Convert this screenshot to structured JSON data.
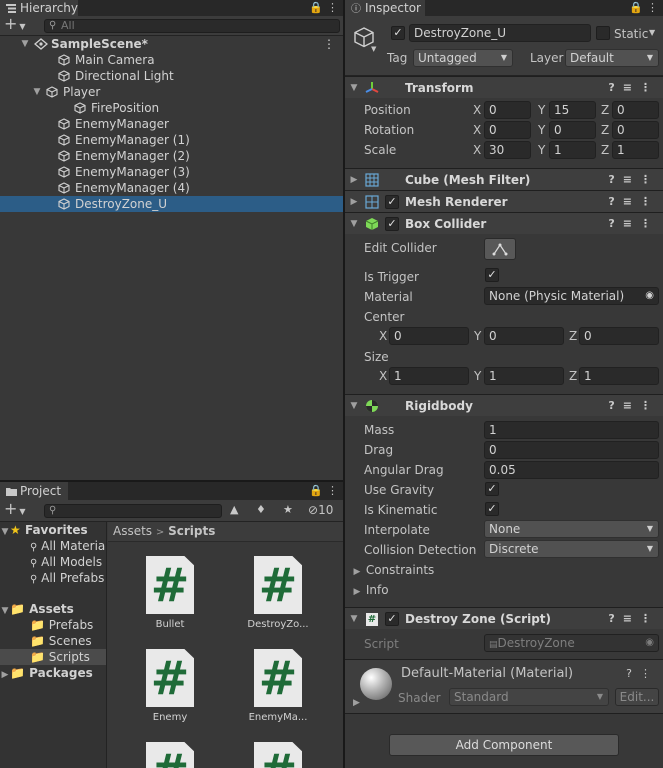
{
  "hierarchy": {
    "tab": "Hierarchy",
    "add": "+",
    "search_placeholder": "All",
    "items": [
      {
        "label": "SampleScene*",
        "kind": "scene"
      },
      {
        "label": "Main Camera",
        "kind": "go"
      },
      {
        "label": "Directional Light",
        "kind": "go"
      },
      {
        "label": "Player",
        "kind": "go"
      },
      {
        "label": "FirePosition",
        "kind": "go"
      },
      {
        "label": "EnemyManager",
        "kind": "go"
      },
      {
        "label": "EnemyManager (1)",
        "kind": "go"
      },
      {
        "label": "EnemyManager (2)",
        "kind": "go"
      },
      {
        "label": "EnemyManager (3)",
        "kind": "go"
      },
      {
        "label": "EnemyManager (4)",
        "kind": "go"
      },
      {
        "label": "DestroyZone_U",
        "kind": "go",
        "selected": true
      }
    ]
  },
  "project": {
    "tab": "Project",
    "add": "+",
    "hidden_count": "10",
    "favorites": {
      "label": "Favorites",
      "items": [
        "All Materia",
        "All Models",
        "All Prefabs"
      ]
    },
    "assets": {
      "label": "Assets",
      "items": [
        "Prefabs",
        "Scenes",
        "Scripts"
      ]
    },
    "packages": "Packages",
    "breadcrumb": {
      "root": "Assets",
      "sep": ">",
      "current": "Scripts"
    },
    "files": [
      {
        "name": "Bullet",
        "glyph": "#"
      },
      {
        "name": "DestroyZo...",
        "glyph": "#"
      },
      {
        "name": "Enemy",
        "glyph": "#"
      },
      {
        "name": "EnemyMa...",
        "glyph": "#"
      },
      {
        "name": "",
        "glyph": "#"
      },
      {
        "name": "",
        "glyph": "#"
      }
    ]
  },
  "inspector": {
    "tab": "Inspector",
    "object_name": "DestroyZone_U",
    "static_label": "Static",
    "tag_label": "Tag",
    "tag_value": "Untagged",
    "layer_label": "Layer",
    "layer_value": "Default",
    "transform": {
      "title": "Transform",
      "rows": [
        {
          "label": "Position",
          "x": "0",
          "y": "15",
          "z": "0"
        },
        {
          "label": "Rotation",
          "x": "0",
          "y": "0",
          "z": "0"
        },
        {
          "label": "Scale",
          "x": "30",
          "y": "1",
          "z": "1"
        }
      ]
    },
    "axes": {
      "x": "X",
      "y": "Y",
      "z": "Z"
    },
    "mesh_filter": {
      "title": "Cube (Mesh Filter)"
    },
    "mesh_renderer": {
      "title": "Mesh Renderer"
    },
    "box_collider": {
      "title": "Box Collider",
      "edit_collider": "Edit Collider",
      "is_trigger": "Is Trigger",
      "material_label": "Material",
      "material_value": "None (Physic Material)",
      "center_label": "Center",
      "center": {
        "x": "0",
        "y": "0",
        "z": "0"
      },
      "size_label": "Size",
      "size": {
        "x": "1",
        "y": "1",
        "z": "1"
      }
    },
    "rigidbody": {
      "title": "Rigidbody",
      "mass_label": "Mass",
      "mass": "1",
      "drag_label": "Drag",
      "drag": "0",
      "angular_drag_label": "Angular Drag",
      "angular_drag": "0.05",
      "use_gravity_label": "Use Gravity",
      "is_kinematic_label": "Is Kinematic",
      "interpolate_label": "Interpolate",
      "interpolate": "None",
      "collision_label": "Collision Detection",
      "collision": "Discrete",
      "constraints": "Constraints",
      "info": "Info"
    },
    "script": {
      "title": "Destroy Zone (Script)",
      "label": "Script",
      "value": "DestroyZone"
    },
    "material": {
      "title": "Default-Material (Material)",
      "shader_label": "Shader",
      "shader_value": "Standard",
      "edit": "Edit..."
    },
    "add_component": "Add Component"
  },
  "colors": {
    "selection": "#2c5d87",
    "script_green": "#1f6b38"
  }
}
